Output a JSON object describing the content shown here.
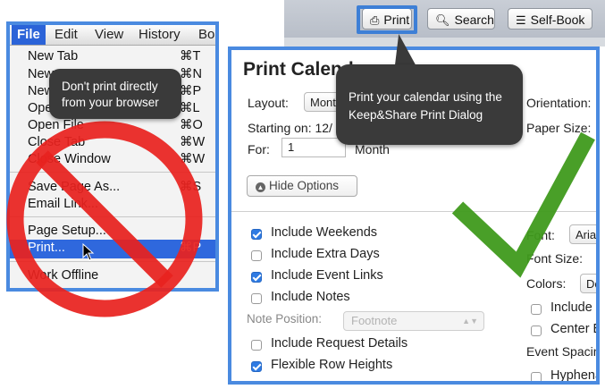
{
  "toolbar": {
    "print_label": "Print",
    "search_label": "Search",
    "selfbook_label": "Self-Book",
    "print_icon": "printer-icon",
    "search_icon": "search-icon",
    "selfbook_icon": "list-icon"
  },
  "browser_menu": {
    "menubar": [
      "File",
      "Edit",
      "View",
      "History",
      "Bo"
    ],
    "items": [
      {
        "label": "New Tab",
        "key": "⌘T"
      },
      {
        "label": "New",
        "key": "⌘N"
      },
      {
        "label": "New",
        "key": "⌘P"
      },
      {
        "label": "Ope",
        "key": "⌘L"
      },
      {
        "label": "Open File",
        "key": "⌘O"
      },
      {
        "label": "Close Tab",
        "key": "⌘W"
      },
      {
        "label": "Close Window",
        "key": "⌘W"
      },
      {
        "label": "Save Page As...",
        "key": "⌘S"
      },
      {
        "label": "Email Link...",
        "key": ""
      },
      {
        "label": "Page Setup...",
        "key": ""
      },
      {
        "label": "Print...",
        "key": "⌘P"
      },
      {
        "label": "Work Offline",
        "key": ""
      }
    ]
  },
  "tooltip_browser": "Don't print directly from your browser",
  "tooltip_dialog": "Print your calendar using the Keep&Share Print Dialog",
  "dialog": {
    "title": "Print Calendar",
    "layout_label": "Layout:",
    "layout_value": "Month",
    "starting_label": "Starting on: 12/",
    "for_label": "For:",
    "for_value": "1",
    "for_unit": "Month",
    "orientation_label": "Orientation:",
    "paper_size_label": "Paper Size:",
    "hide_options": "Hide Options",
    "checkboxes": [
      {
        "label": "Include Weekends",
        "checked": true
      },
      {
        "label": "Include Extra Days",
        "checked": false
      },
      {
        "label": "Include Event Links",
        "checked": true
      },
      {
        "label": "Include Notes",
        "checked": false
      }
    ],
    "note_position_label": "Note Position:",
    "note_position_value": "Footnote",
    "checkboxes2": [
      {
        "label": "Include Request Details",
        "checked": false
      },
      {
        "label": "Flexible Row Heights",
        "checked": true
      }
    ],
    "font_label": "Font:",
    "font_value": "Arial",
    "font_size_label": "Font Size:",
    "colors_label": "Colors:",
    "colors_value": "Default",
    "right_checkboxes": [
      {
        "label": "Include",
        "checked": false
      },
      {
        "label": "Center Ev",
        "checked": false
      }
    ],
    "event_spacing_label": "Event Spacing",
    "hyphenate_label": "Hyphenate"
  },
  "colors": {
    "frame_blue": "#4a8ae0",
    "prohibit_red": "#e8221f",
    "check_green": "#3f9a1c",
    "tooltip_bg": "#3a3a3a"
  }
}
